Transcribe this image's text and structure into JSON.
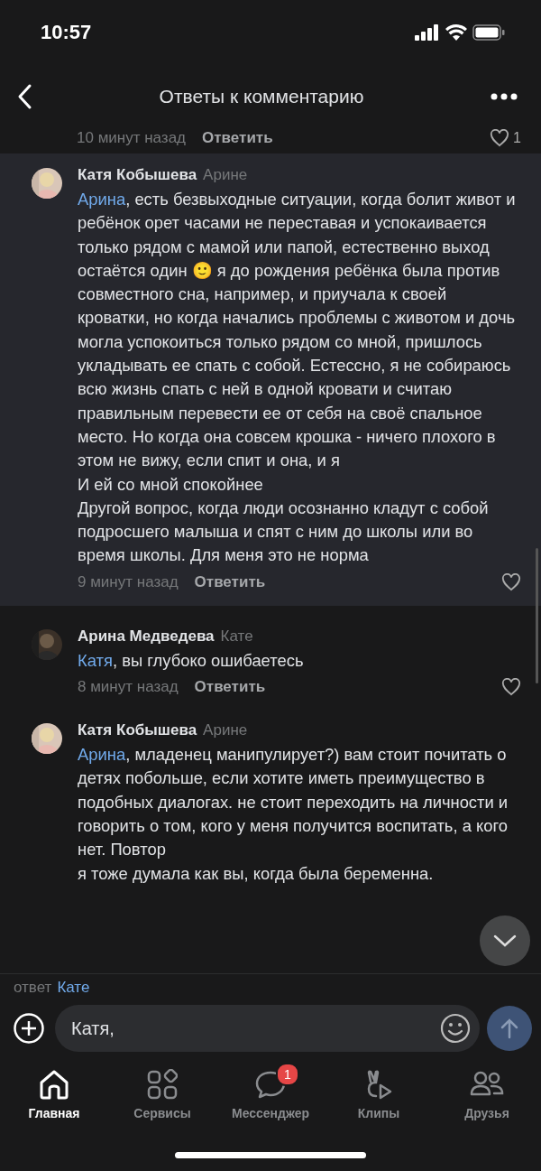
{
  "status_bar": {
    "time": "10:57"
  },
  "header": {
    "title": "Ответы к комментарию"
  },
  "previous_comment": {
    "time": "10 минут назад",
    "reply": "Ответить",
    "likes": "1"
  },
  "comments": [
    {
      "author": "Катя Кобышева",
      "addressee": "Арине",
      "mention": "Арина",
      "text": ", есть безвыходные ситуации, когда болит живот и ребёнок орет часами не переставая и успокаивается только рядом с мамой или папой, естественно выход остаётся один 🙂 я до рождения ребёнка была против совместного сна, например, и приучала к своей кроватки, но когда начались проблемы с животом и дочь могла успокоиться только рядом со мной, пришлось укладывать ее спать с собой. Естессно, я не собираюсь всю жизнь спать с ней в одной кровати и считаю правильным перевести ее от себя на своё спальное место. Но когда она совсем крошка - ничего плохого в этом не вижу, если спит и она, и я\nИ ей со мной спокойнее\nДругой вопрос, когда люди осознанно кладут с собой подросшего малыша и спят с ним до школы или во время школы. Для меня это не норма",
      "time": "9 минут назад",
      "reply": "Ответить",
      "selected": true
    },
    {
      "author": "Арина Медведева",
      "addressee": "Кате",
      "mention": "Катя",
      "text": ", вы глубоко ошибаетесь",
      "time": "8 минут назад",
      "reply": "Ответить",
      "selected": false
    },
    {
      "author": "Катя Кобышева",
      "addressee": "Арине",
      "mention": "Арина",
      "text": ", младенец манипулирует?)  вам стоит почитать о детях побольше, если хотите иметь преимущество в подобных диалогах. не стоит переходить на личности и говорить о том, кого у меня получится воспитать, а кого нет. Повтор\nя тоже думала как вы, когда была беременна.",
      "selected": false
    }
  ],
  "reply_to": {
    "label": "ответ",
    "name": "Кате"
  },
  "composer": {
    "value": "Катя,"
  },
  "tabs": [
    {
      "kind": "home",
      "label": "Главная",
      "selected": true
    },
    {
      "kind": "services",
      "label": "Сервисы",
      "selected": false
    },
    {
      "kind": "messenger",
      "label": "Мессенджер",
      "selected": false,
      "badge": "1"
    },
    {
      "kind": "clips",
      "label": "Клипы",
      "selected": false
    },
    {
      "kind": "friends",
      "label": "Друзья",
      "selected": false
    }
  ]
}
